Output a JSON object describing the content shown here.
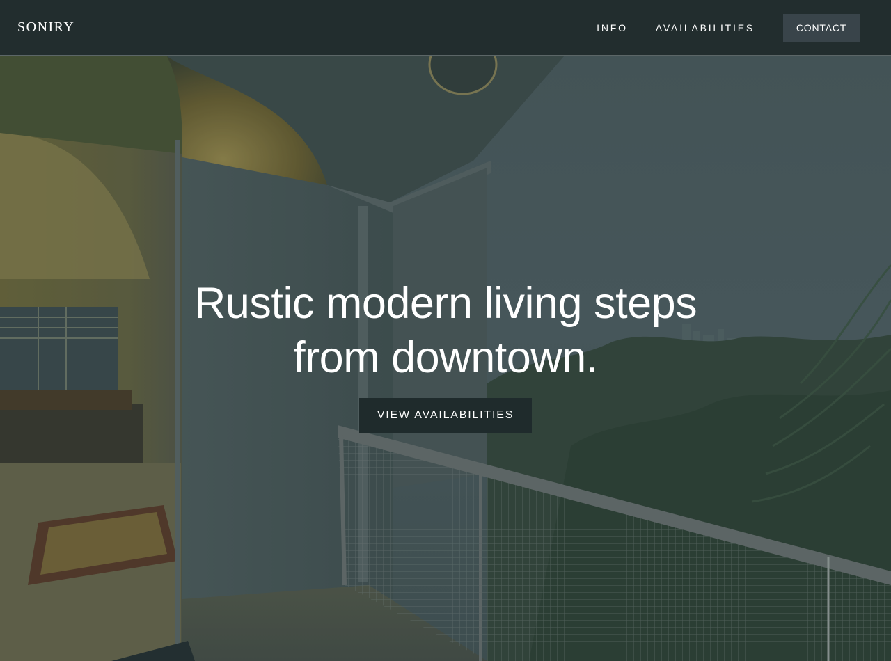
{
  "header": {
    "brand": "SONIRY",
    "nav": {
      "info": "INFO",
      "availabilities": "AVAILABILITIES",
      "contact": "CONTACT"
    }
  },
  "hero": {
    "headline_line1": "Rustic modern living steps",
    "headline_line2": "from downtown.",
    "cta": "VIEW AVAILABILITIES"
  },
  "colors": {
    "header_bg": "#222d2e",
    "contact_bg": "#39444a",
    "cta_bg": "#1f2b2c",
    "text": "#ffffff"
  }
}
